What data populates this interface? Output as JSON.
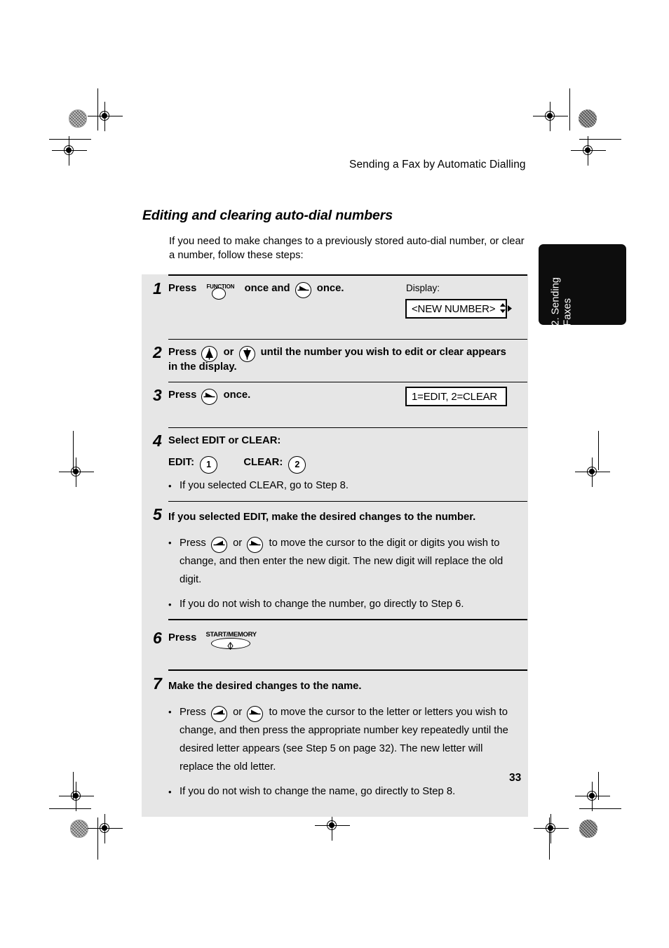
{
  "page": {
    "running_head": "Sending a Fax by Automatic Dialling",
    "section_title": "Editing and clearing auto-dial numbers",
    "intro": "If you need to make changes to a previously stored auto-dial number, or clear a number, follow these steps:",
    "page_number": "33",
    "side_tab": "2. Sending\nFaxes"
  },
  "steps": {
    "s1": {
      "num": "1",
      "press": "Press",
      "func_key_label": "FUNCTION",
      "mid": "once and",
      "tail": "once.",
      "display_label": "Display:",
      "display_text": "<NEW NUMBER>"
    },
    "s2": {
      "num": "2",
      "press": "Press",
      "or": "or",
      "text": "until the number you wish to edit or clear appears in the display."
    },
    "s3": {
      "num": "3",
      "press": "Press",
      "tail": "once.",
      "display_text": "1=EDIT, 2=CLEAR"
    },
    "s4": {
      "num": "4",
      "title": "Select EDIT or CLEAR:",
      "edit_label": "EDIT:",
      "edit_key": "1",
      "clear_label": "CLEAR:",
      "clear_key": "2",
      "bullet1": "If you selected CLEAR, go to Step 8."
    },
    "s5": {
      "num": "5",
      "title": "If you selected EDIT, make the desired changes to the number.",
      "bullet1_press": "Press",
      "bullet1_or": "or",
      "bullet1_text": "to move the cursor to the digit or digits you wish to change, and then enter the new digit. The new digit will replace the old digit.",
      "bullet2": "If you do not wish to change the number, go directly to Step 6."
    },
    "s6": {
      "num": "6",
      "press": "Press",
      "start_key_label": "START/MEMORY"
    },
    "s7": {
      "num": "7",
      "title": "Make the desired changes to the name.",
      "bullet1_press": "Press",
      "bullet1_or": "or",
      "bullet1_text": "to move the cursor to the letter or letters you wish to change, and then press the appropriate number key repeatedly until the desired letter appears (see Step 5 on page 32). The new letter will replace the old letter.",
      "bullet2": "If you do not wish to change the name, go directly to Step 8."
    }
  },
  "bullet_glyph": "•",
  "colors": {
    "procedure_background": "#e6e6e6",
    "side_tab_background": "#0d0d0d",
    "text": "#000000",
    "display_background": "#ffffff"
  }
}
